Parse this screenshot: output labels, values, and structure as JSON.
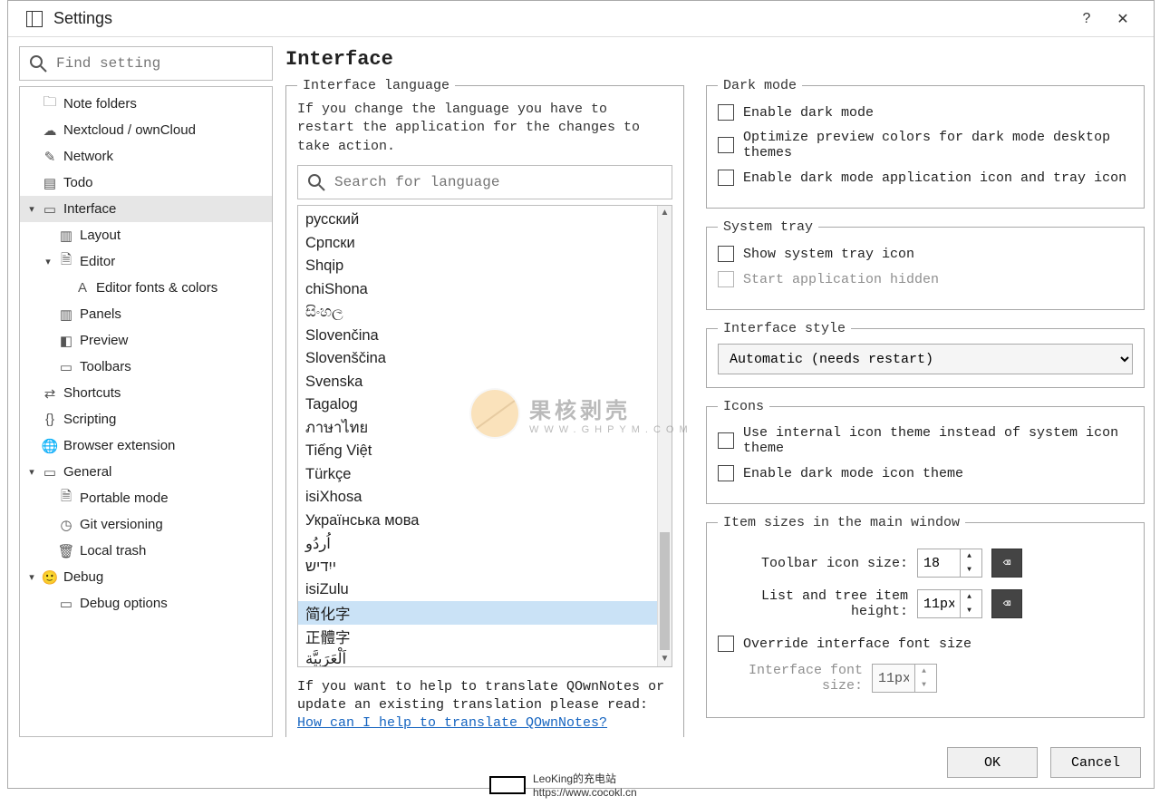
{
  "window": {
    "title": "Settings"
  },
  "search": {
    "placeholder": "Find setting"
  },
  "tree": [
    {
      "id": "note-folders",
      "label": "Note folders",
      "depth": 1,
      "twisty": "",
      "icon": "folder"
    },
    {
      "id": "nextcloud",
      "label": "Nextcloud / ownCloud",
      "depth": 1,
      "twisty": "",
      "icon": "cloud"
    },
    {
      "id": "network",
      "label": "Network",
      "depth": 1,
      "twisty": "",
      "icon": "pen"
    },
    {
      "id": "todo",
      "label": "Todo",
      "depth": 1,
      "twisty": "",
      "icon": "list"
    },
    {
      "id": "interface",
      "label": "Interface",
      "depth": 1,
      "twisty": "▾",
      "icon": "panel",
      "selected": true
    },
    {
      "id": "layout",
      "label": "Layout",
      "depth": 2,
      "twisty": "",
      "icon": "layout"
    },
    {
      "id": "editor",
      "label": "Editor",
      "depth": 2,
      "twisty": "▾",
      "icon": "doc"
    },
    {
      "id": "editor-fonts",
      "label": "Editor fonts & colors",
      "depth": 3,
      "twisty": "",
      "icon": "font"
    },
    {
      "id": "panels",
      "label": "Panels",
      "depth": 2,
      "twisty": "",
      "icon": "layout"
    },
    {
      "id": "preview",
      "label": "Preview",
      "depth": 2,
      "twisty": "",
      "icon": "preview"
    },
    {
      "id": "toolbars",
      "label": "Toolbars",
      "depth": 2,
      "twisty": "",
      "icon": "panel"
    },
    {
      "id": "shortcuts",
      "label": "Shortcuts",
      "depth": 1,
      "twisty": "",
      "icon": "shortcut"
    },
    {
      "id": "scripting",
      "label": "Scripting",
      "depth": 1,
      "twisty": "",
      "icon": "braces"
    },
    {
      "id": "browser-ext",
      "label": "Browser extension",
      "depth": 1,
      "twisty": "",
      "icon": "globe"
    },
    {
      "id": "general",
      "label": "General",
      "depth": 1,
      "twisty": "▾",
      "icon": "panel"
    },
    {
      "id": "portable",
      "label": "Portable mode",
      "depth": 2,
      "twisty": "",
      "icon": "file"
    },
    {
      "id": "git",
      "label": "Git versioning",
      "depth": 2,
      "twisty": "",
      "icon": "clock"
    },
    {
      "id": "trash",
      "label": "Local trash",
      "depth": 2,
      "twisty": "",
      "icon": "trash"
    },
    {
      "id": "debug",
      "label": "Debug",
      "depth": 1,
      "twisty": "▾",
      "icon": "smile"
    },
    {
      "id": "debug-options",
      "label": "Debug options",
      "depth": 2,
      "twisty": "",
      "icon": "panel"
    }
  ],
  "page": {
    "heading": "Interface",
    "lang_group": "Interface language",
    "lang_note": "If you change the language you have to restart the application for the changes to take action.",
    "lang_search_placeholder": "Search for language",
    "languages": [
      "русский",
      "Српски",
      "Shqip",
      "chiShona",
      "සිංහල",
      "Slovenčina",
      "Slovenščina",
      "Svenska",
      "Tagalog",
      "ภาษาไทย",
      "Tiếng Việt",
      "Türkçe",
      "isiXhosa",
      "Українська мова",
      "اُردُو",
      "ייִדיש",
      "isiZulu",
      "简化字",
      "正體字",
      "اَلْعَرَبِيَّة"
    ],
    "lang_selected_index": 17,
    "translate_prefix": "If you want to help to translate QOwnNotes or update an existing translation please read: ",
    "translate_link": "How can I help to translate QOwnNotes?",
    "darkmode": {
      "legend": "Dark mode",
      "enable": "Enable dark mode",
      "optimize": "Optimize preview colors for dark mode desktop themes",
      "icon": "Enable dark mode application icon and tray icon"
    },
    "tray": {
      "legend": "System tray",
      "show": "Show system tray icon",
      "hidden": "Start application hidden"
    },
    "style": {
      "legend": "Interface style",
      "value": "Automatic (needs restart)"
    },
    "icons": {
      "legend": "Icons",
      "internal": "Use internal icon theme instead of system icon theme",
      "dark": "Enable dark mode icon theme"
    },
    "sizes": {
      "legend": "Item sizes in the main window",
      "toolbar_label": "Toolbar icon size:",
      "toolbar_value": "18",
      "list_label": "List and tree item height:",
      "list_value": "11px",
      "override_label": "Override interface font size",
      "font_label": "Interface font size:",
      "font_value": "11px"
    }
  },
  "footer": {
    "ok": "OK",
    "cancel": "Cancel"
  },
  "watermark": {
    "big": "果核剥壳",
    "small": "WWW.GHPYM.COM"
  },
  "credit": {
    "line1": "LeoKing的充电站",
    "line2": "https://www.cocokl.cn"
  }
}
